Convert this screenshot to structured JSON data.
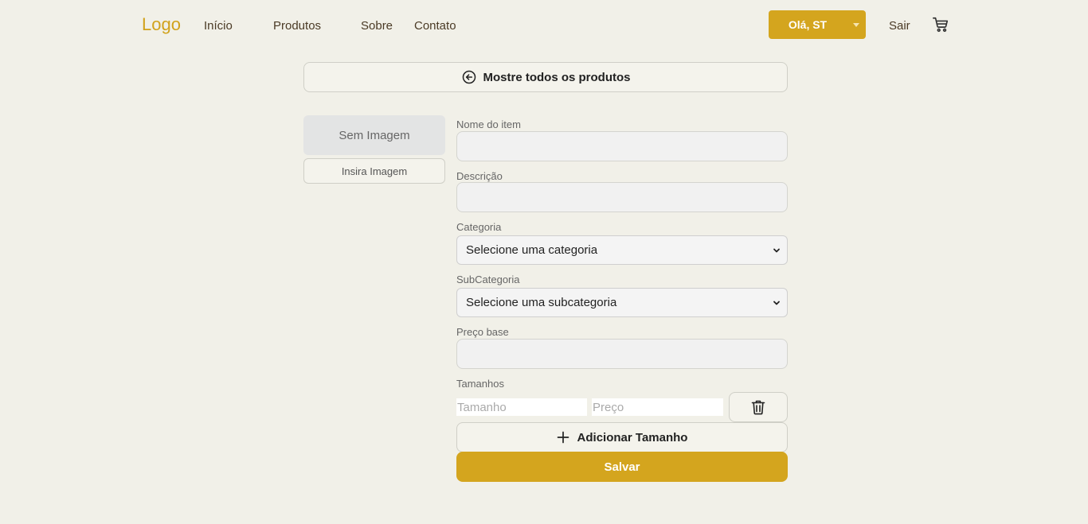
{
  "header": {
    "logo": "Logo",
    "nav": [
      "Início",
      "Produtos",
      "Sobre",
      "Contato"
    ],
    "user_label": "Olá, ST",
    "logout_label": "Sair",
    "cart_icon": "cart-icon"
  },
  "back_button": {
    "label": "Mostre todos os produtos",
    "icon": "arrow-left-circle-icon"
  },
  "image_panel": {
    "placeholder": "Sem Imagem",
    "insert_label": "Insira Imagem"
  },
  "form": {
    "name_label": "Nome do item",
    "name_value": "",
    "description_label": "Descrição",
    "description_value": "",
    "category_label": "Categoria",
    "category_selected": "Selecione uma categoria",
    "subcategory_label": "SubCategoria",
    "subcategory_selected": "Selecione uma subcategoria",
    "price_label": "Preço base",
    "price_value": "",
    "sizes_label": "Tamanhos",
    "size_placeholder": "Tamanho",
    "size_price_placeholder": "Preço",
    "add_size_label": "Adicionar Tamanho",
    "save_label": "Salvar"
  },
  "colors": {
    "accent": "#d4a51e",
    "logo": "#d1a21c",
    "background": "#f1f0e8"
  }
}
